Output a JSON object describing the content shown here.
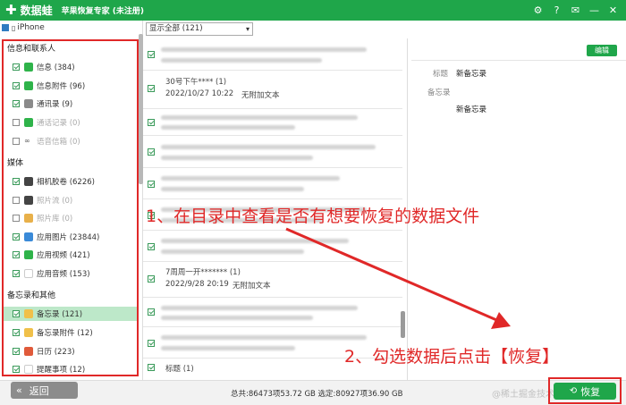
{
  "app": {
    "logo_text": "数据蛙",
    "title": "苹果恢复专家 (未注册)"
  },
  "window_controls": [
    "gear-icon",
    "help-icon",
    "feedback-icon",
    "minimize-icon",
    "close-icon"
  ],
  "sidebar": {
    "device": "iPhone",
    "sections": [
      {
        "title": "信息和联系人",
        "items": [
          {
            "label": "信息 (384)",
            "checked": true,
            "icon_color": "#2fb34a"
          },
          {
            "label": "信息附件 (96)",
            "checked": true,
            "icon_color": "#2fb34a"
          },
          {
            "label": "通讯录 (9)",
            "checked": true,
            "icon_color": "#8a8a8a"
          },
          {
            "label": "通话记录 (0)",
            "checked": false,
            "icon_color": "#2fb34a"
          },
          {
            "label": "语音信箱 (0)",
            "checked": false,
            "icon_color": "#555"
          }
        ]
      },
      {
        "title": "媒体",
        "items": [
          {
            "label": "相机胶卷 (6226)",
            "checked": true,
            "icon_color": "#444"
          },
          {
            "label": "照片流 (0)",
            "checked": false,
            "icon_color": "#444"
          },
          {
            "label": "照片库 (0)",
            "checked": false,
            "icon_color": "#e8b04a"
          },
          {
            "label": "应用图片 (23844)",
            "checked": true,
            "icon_color": "#3a8ad8"
          },
          {
            "label": "应用视频 (421)",
            "checked": true,
            "icon_color": "#2fb34a"
          },
          {
            "label": "应用音频 (153)",
            "checked": true,
            "icon_color": "#dddddd"
          }
        ]
      },
      {
        "title": "备忘录和其他",
        "items": [
          {
            "label": "备忘录 (121)",
            "checked": true,
            "icon_color": "#f0c04a",
            "selected": true
          },
          {
            "label": "备忘录附件 (12)",
            "checked": true,
            "icon_color": "#f0c04a"
          },
          {
            "label": "日历 (223)",
            "checked": true,
            "icon_color": "#e05a3a"
          },
          {
            "label": "提醒事项 (12)",
            "checked": true,
            "icon_color": "#dddddd"
          }
        ]
      }
    ]
  },
  "middle": {
    "filter": "显示全部 (121)",
    "rows": [
      {
        "title": "30号下午**** (1)",
        "date": "2022/10/27 10:22",
        "note": "无附加文本",
        "checked": true
      },
      {
        "title": "7周周一开******* (1)",
        "date": "2022/9/28 20:19",
        "note": "无附加文本",
        "checked": true
      },
      {
        "title": "标题 (1)",
        "date": "",
        "note": "",
        "checked": true
      }
    ]
  },
  "detail": {
    "edit_label": "编辑",
    "title_label": "标题",
    "title_value": "新备忘录",
    "memo_label": "备忘录",
    "memo_value": "新备忘录"
  },
  "bottom": {
    "back_label": "返回",
    "stats": "总共:86473项53.72 GB 选定:80927项36.90 GB",
    "recover_label": "恢复",
    "watermark": "@稀土掘金技术社区"
  },
  "annotations": {
    "step1": "1、在目录中查看是否有想要恢复的数据文件",
    "step2": "2、勾选数据后点击【恢复】"
  }
}
